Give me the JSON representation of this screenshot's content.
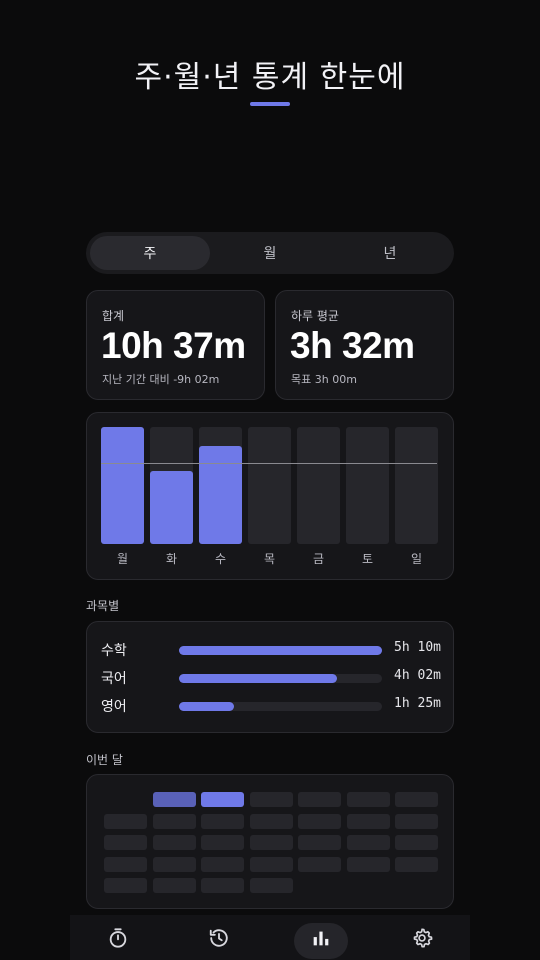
{
  "header": {
    "title": "주·월·년 통계 한눈에"
  },
  "period_tabs": [
    {
      "label": "주",
      "active": true
    },
    {
      "label": "월",
      "active": false
    },
    {
      "label": "년",
      "active": false
    }
  ],
  "total_card": {
    "label": "합계",
    "value": "10h 37m",
    "sub": "지난 기간 대비 -9h 02m"
  },
  "average_card": {
    "label": "하루 평균",
    "value": "3h 32m",
    "sub": "목표 3h 00m"
  },
  "weekly_chart": {
    "days": [
      "월",
      "화",
      "수",
      "목",
      "금",
      "토",
      "일"
    ],
    "fill_fraction": [
      1.0,
      0.62,
      0.84,
      0,
      0,
      0,
      0
    ],
    "average_line_fraction": 0.69,
    "accent_color": "#6f79e8"
  },
  "subjects_section": {
    "label": "과목별",
    "items": [
      {
        "name": "수학",
        "time": "5h 10m",
        "fraction": 1.0
      },
      {
        "name": "국어",
        "time": "4h 02m",
        "fraction": 0.78
      },
      {
        "name": "영어",
        "time": "1h 25m",
        "fraction": 0.27
      }
    ]
  },
  "month_section": {
    "label": "이번 달",
    "first_weekday_offset": 1,
    "days_in_month": 31,
    "levels": [
      1,
      2,
      0,
      0,
      0,
      0,
      0,
      0,
      0,
      0,
      0,
      0,
      0,
      0,
      0,
      0,
      0,
      0,
      0,
      0,
      0,
      0,
      0,
      0,
      0,
      0,
      0,
      0,
      0,
      0,
      0
    ]
  },
  "bottom_nav": {
    "items": [
      {
        "icon": "timer-icon",
        "active": false
      },
      {
        "icon": "history-icon",
        "active": false
      },
      {
        "icon": "bar-chart-icon",
        "active": true
      },
      {
        "icon": "gear-icon",
        "active": false
      }
    ]
  }
}
